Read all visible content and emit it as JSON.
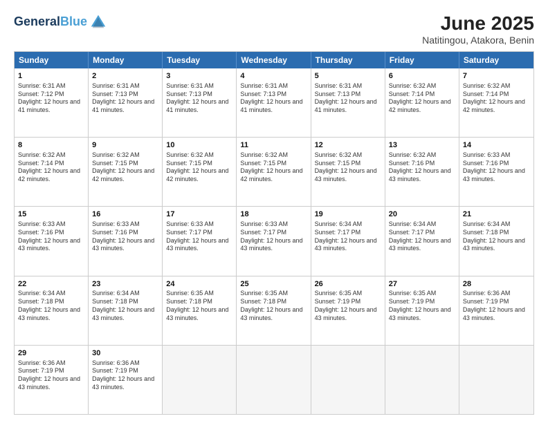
{
  "header": {
    "logo_line1": "General",
    "logo_line2": "Blue",
    "title": "June 2025",
    "subtitle": "Natitingou, Atakora, Benin"
  },
  "weekdays": [
    "Sunday",
    "Monday",
    "Tuesday",
    "Wednesday",
    "Thursday",
    "Friday",
    "Saturday"
  ],
  "rows": [
    [
      {
        "day": "1",
        "sunrise": "Sunrise: 6:31 AM",
        "sunset": "Sunset: 7:12 PM",
        "daylight": "Daylight: 12 hours and 41 minutes."
      },
      {
        "day": "2",
        "sunrise": "Sunrise: 6:31 AM",
        "sunset": "Sunset: 7:13 PM",
        "daylight": "Daylight: 12 hours and 41 minutes."
      },
      {
        "day": "3",
        "sunrise": "Sunrise: 6:31 AM",
        "sunset": "Sunset: 7:13 PM",
        "daylight": "Daylight: 12 hours and 41 minutes."
      },
      {
        "day": "4",
        "sunrise": "Sunrise: 6:31 AM",
        "sunset": "Sunset: 7:13 PM",
        "daylight": "Daylight: 12 hours and 41 minutes."
      },
      {
        "day": "5",
        "sunrise": "Sunrise: 6:31 AM",
        "sunset": "Sunset: 7:13 PM",
        "daylight": "Daylight: 12 hours and 41 minutes."
      },
      {
        "day": "6",
        "sunrise": "Sunrise: 6:32 AM",
        "sunset": "Sunset: 7:14 PM",
        "daylight": "Daylight: 12 hours and 42 minutes."
      },
      {
        "day": "7",
        "sunrise": "Sunrise: 6:32 AM",
        "sunset": "Sunset: 7:14 PM",
        "daylight": "Daylight: 12 hours and 42 minutes."
      }
    ],
    [
      {
        "day": "8",
        "sunrise": "Sunrise: 6:32 AM",
        "sunset": "Sunset: 7:14 PM",
        "daylight": "Daylight: 12 hours and 42 minutes."
      },
      {
        "day": "9",
        "sunrise": "Sunrise: 6:32 AM",
        "sunset": "Sunset: 7:15 PM",
        "daylight": "Daylight: 12 hours and 42 minutes."
      },
      {
        "day": "10",
        "sunrise": "Sunrise: 6:32 AM",
        "sunset": "Sunset: 7:15 PM",
        "daylight": "Daylight: 12 hours and 42 minutes."
      },
      {
        "day": "11",
        "sunrise": "Sunrise: 6:32 AM",
        "sunset": "Sunset: 7:15 PM",
        "daylight": "Daylight: 12 hours and 42 minutes."
      },
      {
        "day": "12",
        "sunrise": "Sunrise: 6:32 AM",
        "sunset": "Sunset: 7:15 PM",
        "daylight": "Daylight: 12 hours and 43 minutes."
      },
      {
        "day": "13",
        "sunrise": "Sunrise: 6:32 AM",
        "sunset": "Sunset: 7:16 PM",
        "daylight": "Daylight: 12 hours and 43 minutes."
      },
      {
        "day": "14",
        "sunrise": "Sunrise: 6:33 AM",
        "sunset": "Sunset: 7:16 PM",
        "daylight": "Daylight: 12 hours and 43 minutes."
      }
    ],
    [
      {
        "day": "15",
        "sunrise": "Sunrise: 6:33 AM",
        "sunset": "Sunset: 7:16 PM",
        "daylight": "Daylight: 12 hours and 43 minutes."
      },
      {
        "day": "16",
        "sunrise": "Sunrise: 6:33 AM",
        "sunset": "Sunset: 7:16 PM",
        "daylight": "Daylight: 12 hours and 43 minutes."
      },
      {
        "day": "17",
        "sunrise": "Sunrise: 6:33 AM",
        "sunset": "Sunset: 7:17 PM",
        "daylight": "Daylight: 12 hours and 43 minutes."
      },
      {
        "day": "18",
        "sunrise": "Sunrise: 6:33 AM",
        "sunset": "Sunset: 7:17 PM",
        "daylight": "Daylight: 12 hours and 43 minutes."
      },
      {
        "day": "19",
        "sunrise": "Sunrise: 6:34 AM",
        "sunset": "Sunset: 7:17 PM",
        "daylight": "Daylight: 12 hours and 43 minutes."
      },
      {
        "day": "20",
        "sunrise": "Sunrise: 6:34 AM",
        "sunset": "Sunset: 7:17 PM",
        "daylight": "Daylight: 12 hours and 43 minutes."
      },
      {
        "day": "21",
        "sunrise": "Sunrise: 6:34 AM",
        "sunset": "Sunset: 7:18 PM",
        "daylight": "Daylight: 12 hours and 43 minutes."
      }
    ],
    [
      {
        "day": "22",
        "sunrise": "Sunrise: 6:34 AM",
        "sunset": "Sunset: 7:18 PM",
        "daylight": "Daylight: 12 hours and 43 minutes."
      },
      {
        "day": "23",
        "sunrise": "Sunrise: 6:34 AM",
        "sunset": "Sunset: 7:18 PM",
        "daylight": "Daylight: 12 hours and 43 minutes."
      },
      {
        "day": "24",
        "sunrise": "Sunrise: 6:35 AM",
        "sunset": "Sunset: 7:18 PM",
        "daylight": "Daylight: 12 hours and 43 minutes."
      },
      {
        "day": "25",
        "sunrise": "Sunrise: 6:35 AM",
        "sunset": "Sunset: 7:18 PM",
        "daylight": "Daylight: 12 hours and 43 minutes."
      },
      {
        "day": "26",
        "sunrise": "Sunrise: 6:35 AM",
        "sunset": "Sunset: 7:19 PM",
        "daylight": "Daylight: 12 hours and 43 minutes."
      },
      {
        "day": "27",
        "sunrise": "Sunrise: 6:35 AM",
        "sunset": "Sunset: 7:19 PM",
        "daylight": "Daylight: 12 hours and 43 minutes."
      },
      {
        "day": "28",
        "sunrise": "Sunrise: 6:36 AM",
        "sunset": "Sunset: 7:19 PM",
        "daylight": "Daylight: 12 hours and 43 minutes."
      }
    ],
    [
      {
        "day": "29",
        "sunrise": "Sunrise: 6:36 AM",
        "sunset": "Sunset: 7:19 PM",
        "daylight": "Daylight: 12 hours and 43 minutes."
      },
      {
        "day": "30",
        "sunrise": "Sunrise: 6:36 AM",
        "sunset": "Sunset: 7:19 PM",
        "daylight": "Daylight: 12 hours and 43 minutes."
      },
      null,
      null,
      null,
      null,
      null
    ]
  ]
}
